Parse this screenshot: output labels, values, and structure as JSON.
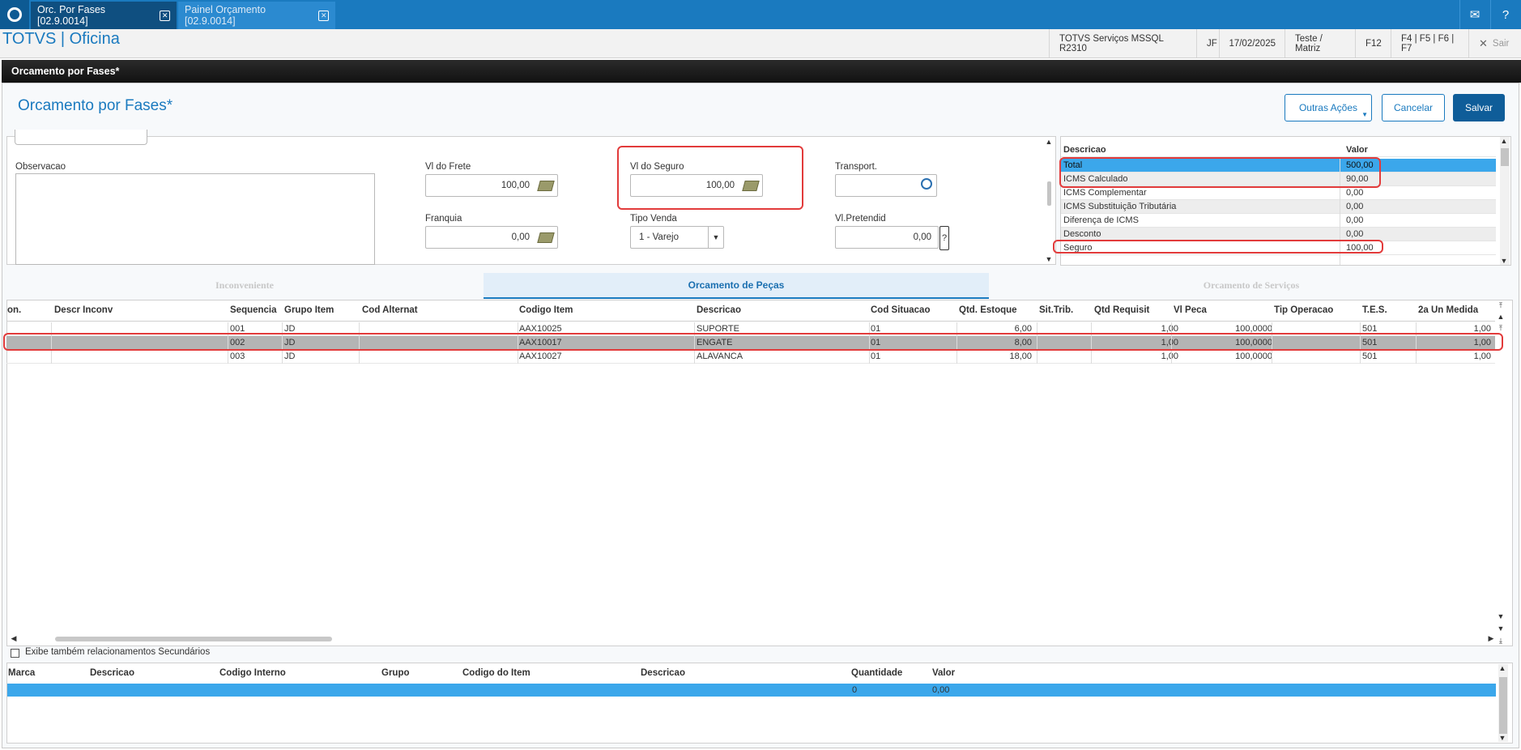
{
  "window_tabs": [
    {
      "label": "Orc. Por Fases [02.9.0014]"
    },
    {
      "label": "Painel Orçamento [02.9.0014]"
    }
  ],
  "app": {
    "title": "TOTVS | Oficina",
    "environment": "TOTVS Serviços MSSQL R2310",
    "user": "JF",
    "date": "17/02/2025",
    "branch": "Teste / Matriz",
    "shortcut_f12": "F12",
    "shortcuts": "F4 | F5 | F6 | F7",
    "exit_label": "Sair"
  },
  "window_title": "Orcamento por Fases*",
  "page_title": "Orcamento por Fases*",
  "buttons": {
    "other_actions": "Outras Ações",
    "cancel": "Cancelar",
    "save": "Salvar"
  },
  "form": {
    "observacao_label": "Observacao",
    "frete_label": "Vl do Frete",
    "frete_value": "100,00",
    "seguro_label": "Vl do Seguro",
    "seguro_value": "100,00",
    "transport_label": "Transport.",
    "transport_value": "",
    "franquia_label": "Franquia",
    "franquia_value": "0,00",
    "tipo_venda_label": "Tipo Venda",
    "tipo_venda_value": "1 - Varejo",
    "pretendid_label": "Vl.Pretendid",
    "pretendid_value": "0,00"
  },
  "summary": {
    "headers": [
      "Descricao",
      "Valor"
    ],
    "rows": [
      {
        "desc": "Total",
        "value": "500,00"
      },
      {
        "desc": "ICMS Calculado",
        "value": "90,00"
      },
      {
        "desc": "ICMS Complementar",
        "value": "0,00"
      },
      {
        "desc": "ICMS Substituição Tributária",
        "value": "0,00"
      },
      {
        "desc": "Diferença de ICMS",
        "value": "0,00"
      },
      {
        "desc": "Desconto",
        "value": "0,00"
      },
      {
        "desc": "Seguro",
        "value": "100,00"
      }
    ]
  },
  "folder_tabs": [
    {
      "label": "Inconveniente"
    },
    {
      "label": "Orcamento de Peças"
    },
    {
      "label": "Orcamento de Serviços"
    }
  ],
  "items_grid": {
    "headers": [
      "on.",
      "Descr Inconv",
      "Sequencia",
      "Grupo Item",
      "Cod Alternat",
      "Codigo Item",
      "Descricao",
      "Cod Situacao",
      "Qtd. Estoque",
      "Sit.Trib.",
      "Qtd Requisit",
      "Vl Peca",
      "Tip Operacao",
      "T.E.S.",
      "2a Un Medida"
    ],
    "rows": [
      {
        "seq": "001",
        "grupo": "JD",
        "codigo": "AAX10025",
        "descricao": "SUPORTE",
        "situacao": "01",
        "estoque": "6,00",
        "requisit": "1,00",
        "peca": "100,0000",
        "tes": "501",
        "un2": "1,00"
      },
      {
        "seq": "002",
        "grupo": "JD",
        "codigo": "AAX10017",
        "descricao": "ENGATE",
        "situacao": "01",
        "estoque": "8,00",
        "requisit": "1,00",
        "peca": "100,0000",
        "tes": "501",
        "un2": "1,00"
      },
      {
        "seq": "003",
        "grupo": "JD",
        "codigo": "AAX10027",
        "descricao": "ALAVANCA",
        "situacao": "01",
        "estoque": "18,00",
        "requisit": "1,00",
        "peca": "100,0000",
        "tes": "501",
        "un2": "1,00"
      }
    ]
  },
  "secondary_checkbox_label": "Exibe também relacionamentos Secundários",
  "bottom_grid": {
    "headers": [
      "Marca",
      "Descricao",
      "Codigo Interno",
      "Grupo",
      "Codigo do Item",
      "Descricao",
      "Quantidade",
      "Valor"
    ],
    "row": {
      "quantidade": "0",
      "valor": "0,00"
    }
  },
  "colors": {
    "accent": "#1a7abf",
    "highlight_red": "#e23b3b",
    "selected_row": "#3ba7eb"
  }
}
